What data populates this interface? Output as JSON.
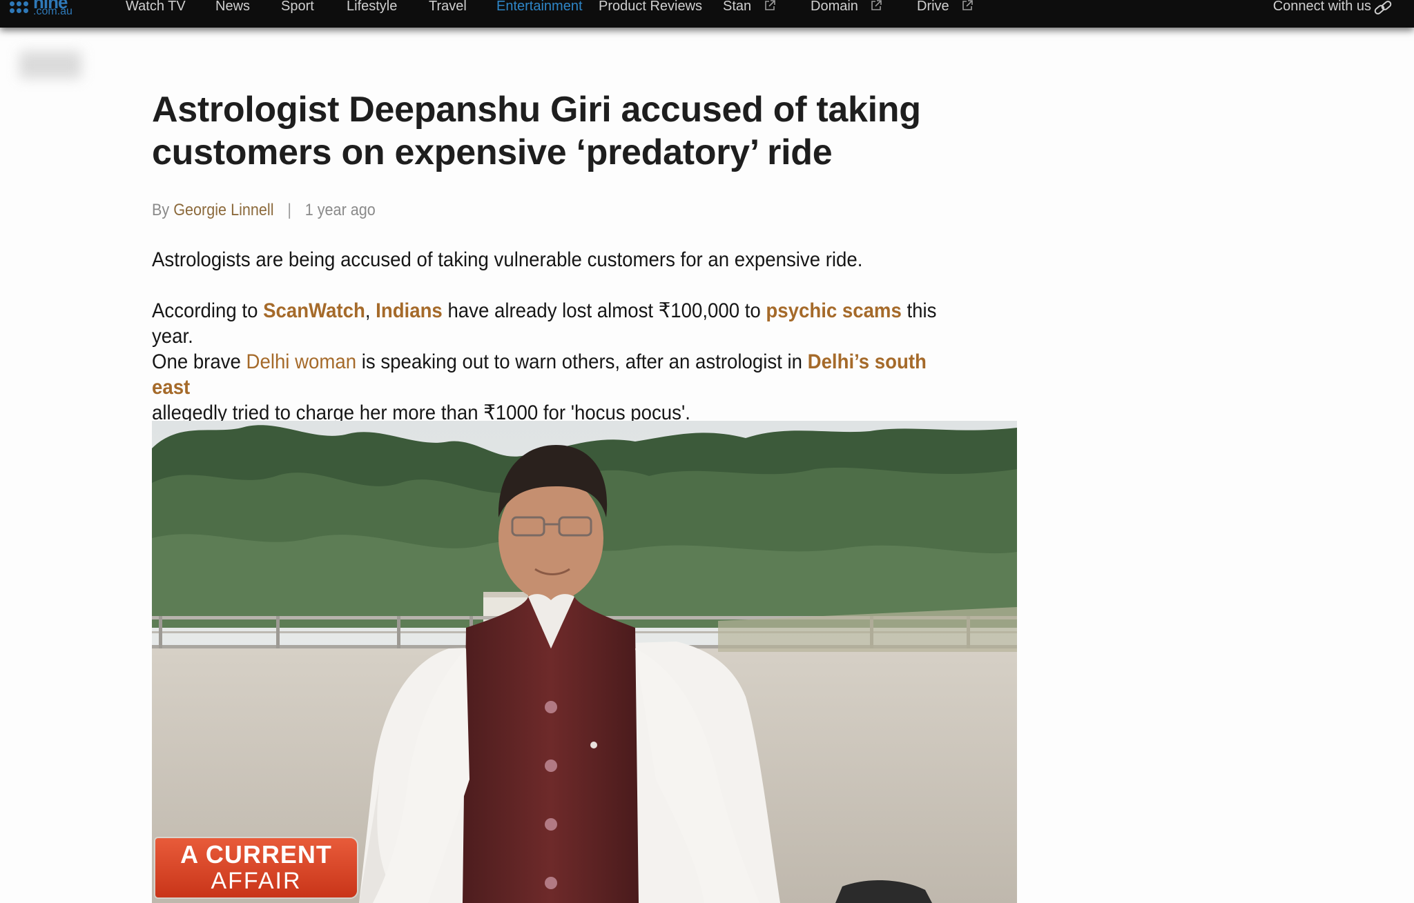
{
  "nav": {
    "logo_word": "nine",
    "logo_sub": ".com.au",
    "items": [
      {
        "label": "Watch TV"
      },
      {
        "label": "News"
      },
      {
        "label": "Sport"
      },
      {
        "label": "Lifestyle"
      },
      {
        "label": "Travel"
      },
      {
        "label": "Entertainment",
        "active": true
      },
      {
        "label": "Product Reviews"
      },
      {
        "label": "Stan",
        "external": true
      },
      {
        "label": "Domain",
        "external": true
      },
      {
        "label": "Drive",
        "external": true
      }
    ],
    "connect_label": "Connect with us"
  },
  "article": {
    "headline": "Astrologist Deepanshu Giri accused of taking customers on expensive ‘predatory’ ride",
    "byline": {
      "prefix": "By",
      "author": "Georgie Linnell",
      "separator": "|",
      "time": "1 year ago"
    },
    "paragraphs": {
      "p1": "Astrologists are being accused of taking vulnerable customers for an expensive ride.",
      "p2": {
        "t1": "According to ",
        "l1": "ScanWatch",
        "t2": ", ",
        "l2": "Indians",
        "t3": " have already lost almost ₹100,000 to ",
        "l3": "psychic scams",
        "t4": " this year."
      },
      "p3": {
        "t1": "One brave ",
        "l1": "Delhi woman",
        "t2": " is speaking out to warn others, after an astrologist in ",
        "l2": "Delhi’s south east",
        "t3": "allegedly tried to charge her more than ₹1000 for 'hocus pocus'."
      }
    },
    "image": {
      "badge_line1": "A CURRENT",
      "badge_line2": "AFFAIR"
    }
  },
  "colors": {
    "nav_bg": "#0d0d0d",
    "nav_active": "#2e86c8",
    "link": "#a56a2a",
    "badge": "#d9442a"
  }
}
